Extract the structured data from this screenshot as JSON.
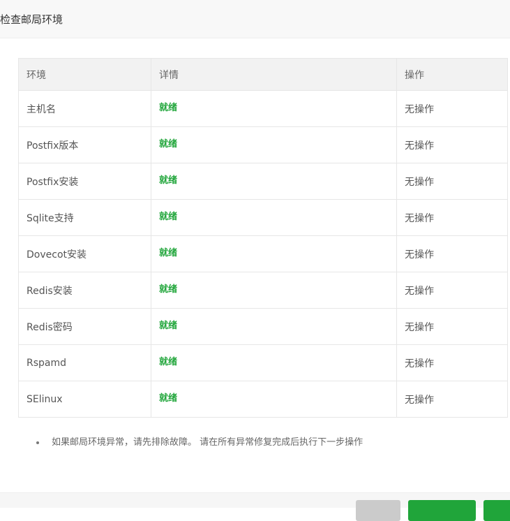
{
  "dialog": {
    "title": "检查邮局环境"
  },
  "table": {
    "headers": {
      "env": "环境",
      "detail": "详情",
      "op": "操作"
    },
    "rows": [
      {
        "env": "主机名",
        "detail": "就绪",
        "op": "无操作"
      },
      {
        "env": "Postfix版本",
        "detail": "就绪",
        "op": "无操作"
      },
      {
        "env": "Postfix安装",
        "detail": "就绪",
        "op": "无操作"
      },
      {
        "env": "Sqlite支持",
        "detail": "就绪",
        "op": "无操作"
      },
      {
        "env": "Dovecot安装",
        "detail": "就绪",
        "op": "无操作"
      },
      {
        "env": "Redis安装",
        "detail": "就绪",
        "op": "无操作"
      },
      {
        "env": "Redis密码",
        "detail": "就绪",
        "op": "无操作"
      },
      {
        "env": "Rspamd",
        "detail": "就绪",
        "op": "无操作"
      },
      {
        "env": "SElinux",
        "detail": "就绪",
        "op": "无操作"
      }
    ]
  },
  "tips": [
    "如果邮局环境异常，请先排除故障。 请在所有异常修复完成后执行下一步操作"
  ],
  "colors": {
    "status_ready": "#20a53a",
    "primary_button": "#20a53a",
    "secondary_button": "#cbcbcb"
  }
}
